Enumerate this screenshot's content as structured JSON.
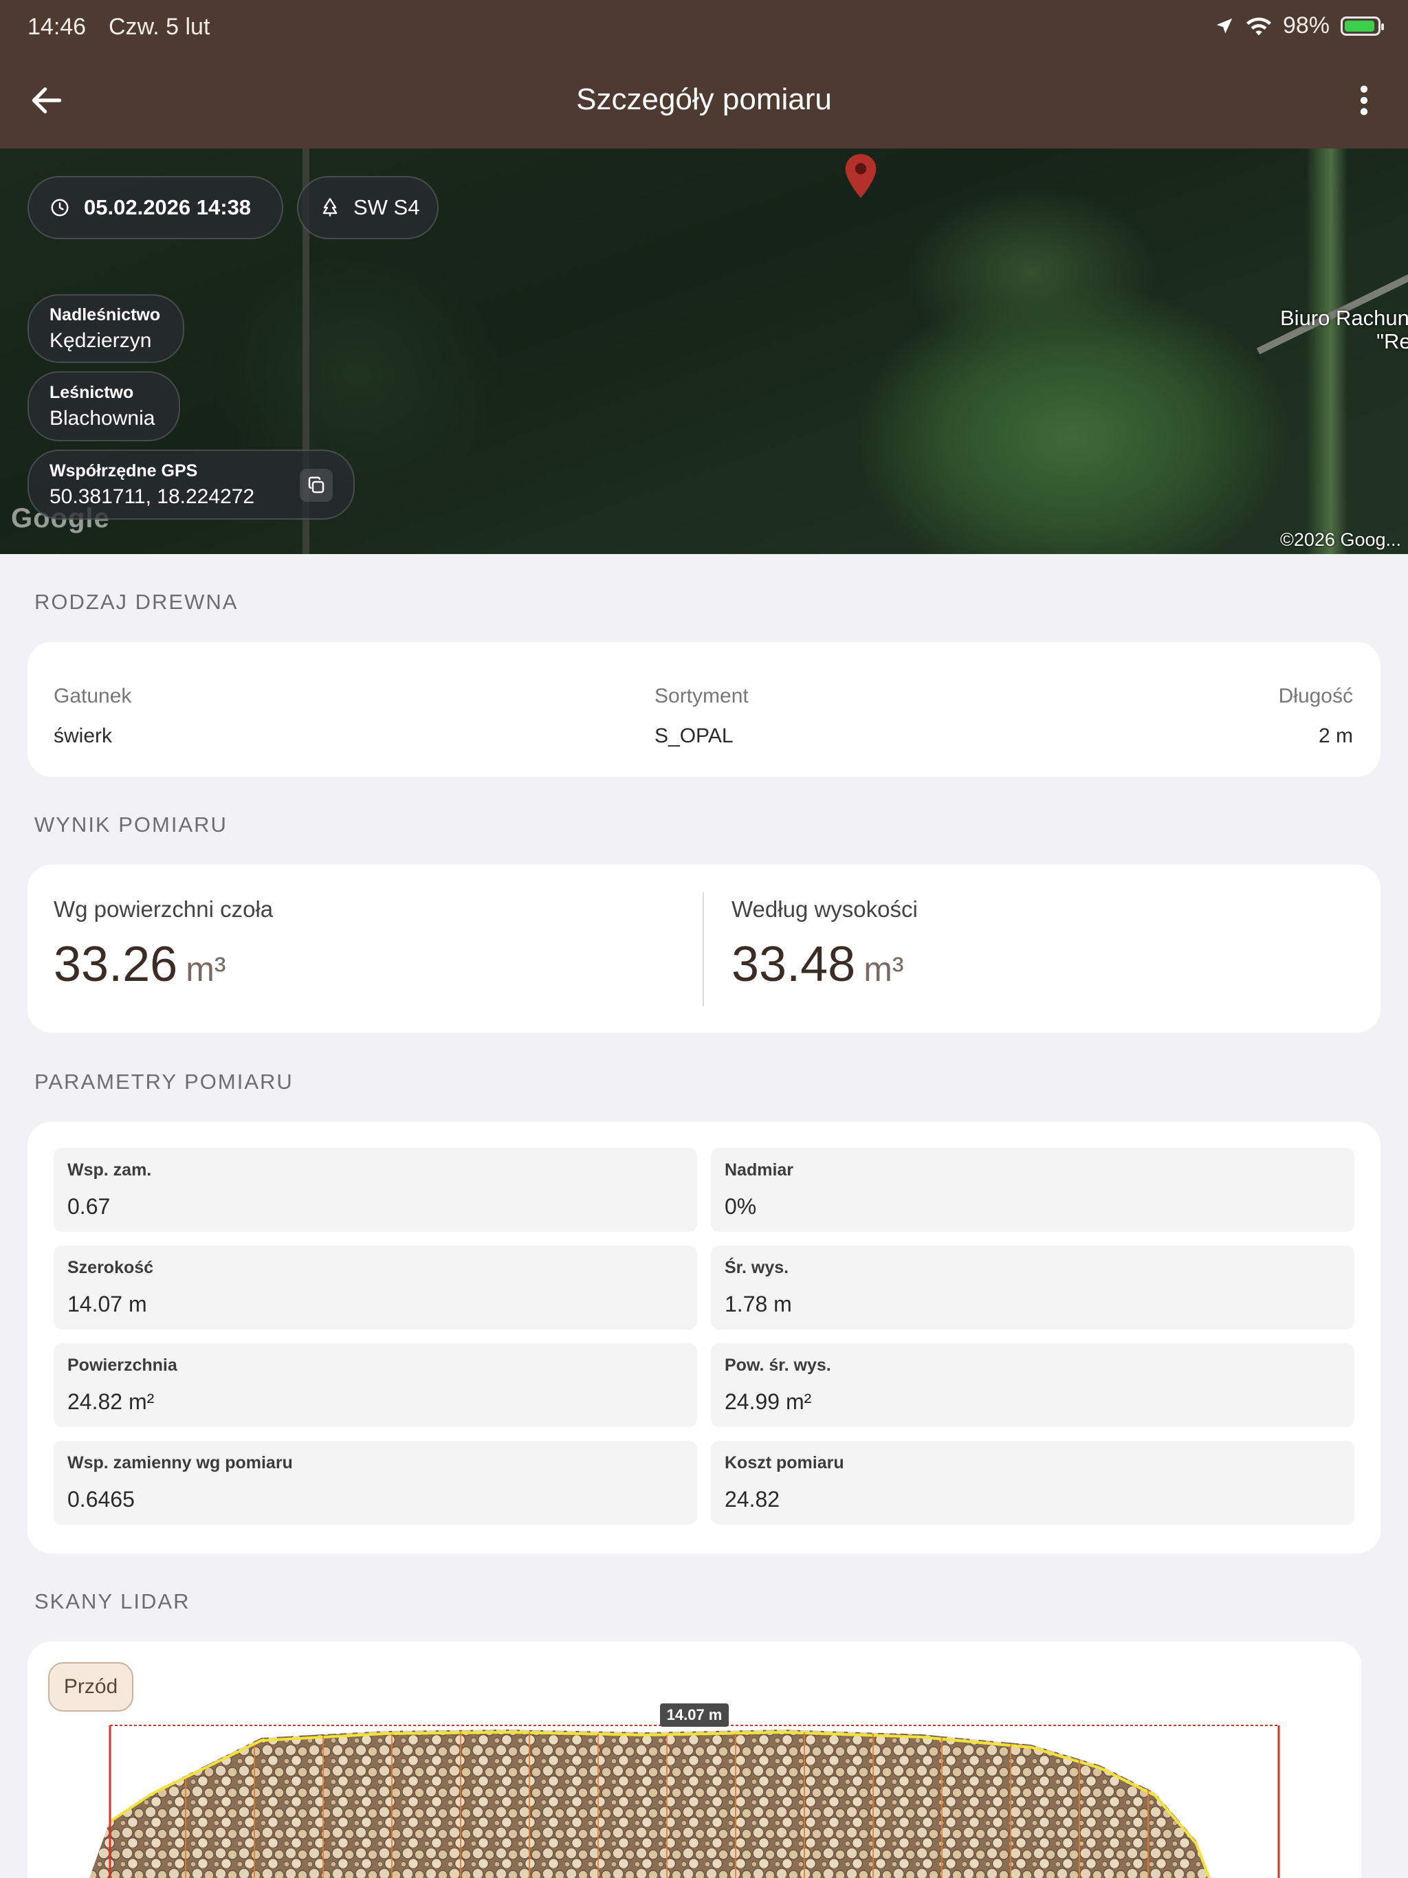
{
  "status": {
    "time": "14:46",
    "date": "Czw. 5 lut",
    "battery": "98%",
    "battery_level": 0.98
  },
  "appbar": {
    "title": "Szczegóły pomiaru",
    "back_icon": "arrow-left-icon",
    "more_icon": "more-vertical-icon"
  },
  "map": {
    "datetime": "05.02.2026 14:38",
    "stack": "SW S4",
    "nadlesnictwo_label": "Nadleśnictwo",
    "nadlesnictwo": "Kędzierzyn",
    "lesnictwo_label": "Leśnictwo",
    "lesnictwo": "Blachownia",
    "gps_label": "Współrzędne GPS",
    "gps": "50.381711, 18.224272",
    "poi_line1": "Biuro Rachun",
    "poi_line2": "\"Re",
    "google": "Google",
    "copyright": "©2026 Goog...",
    "pin_color": "#b3312a"
  },
  "wood": {
    "section_title": "RODZAJ DREWNA",
    "species_label": "Gatunek",
    "species": "świerk",
    "assortment_label": "Sortyment",
    "assortment": "S_OPAL",
    "length_label": "Długość",
    "length": "2 m"
  },
  "result": {
    "section_title": "WYNIK POMIARU",
    "face_label": "Wg powierzchni czoła",
    "face_value": "33.26",
    "face_unit": "m³",
    "height_label": "Według wysokości",
    "height_value": "33.48",
    "height_unit": "m³"
  },
  "params": {
    "section_title": "PARAMETRY POMIARU",
    "items": [
      {
        "label": "Wsp. zam.",
        "value": "0.67"
      },
      {
        "label": "Nadmiar",
        "value": "0%"
      },
      {
        "label": "Szerokość",
        "value": "14.07 m"
      },
      {
        "label": "Śr. wys.",
        "value": "1.78 m"
      },
      {
        "label": "Powierzchnia",
        "value": "24.82 m²"
      },
      {
        "label": "Pow. śr. wys.",
        "value": "24.99 m²"
      },
      {
        "label": "Wsp. zamienny wg pomiaru",
        "value": "0.6465"
      },
      {
        "label": "Koszt pomiaru",
        "value": "24.82"
      }
    ]
  },
  "lidar": {
    "section_title": "SKANY LIDAR",
    "tab": "Przód",
    "width_tag": "14.07 m"
  }
}
